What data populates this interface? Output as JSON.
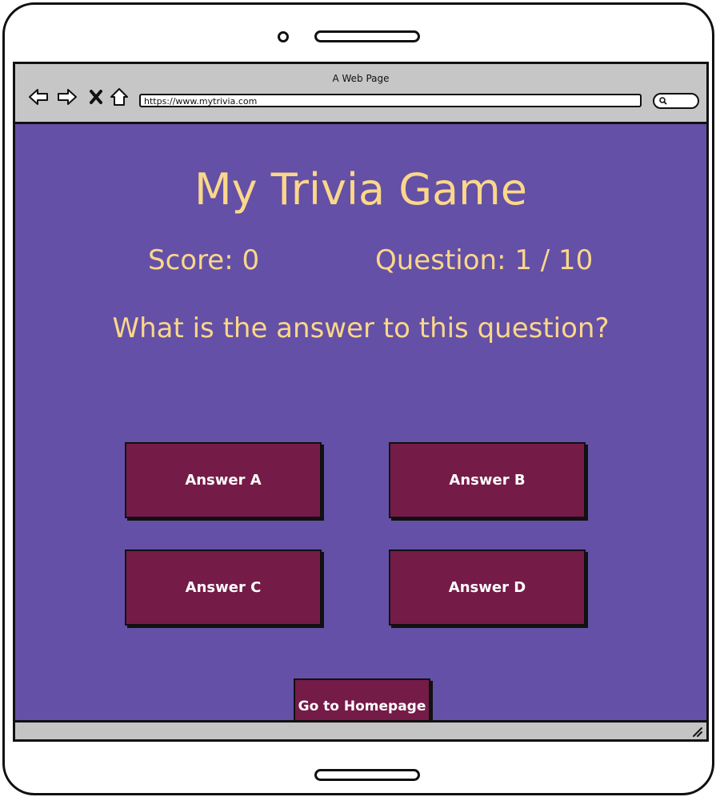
{
  "browser": {
    "window_title": "A Web Page",
    "url": "https://www.mytrivia.com"
  },
  "game": {
    "title": "My Trivia Game",
    "score_text": "Score: 0",
    "question_counter": "Question: 1 / 10",
    "question": "What is the answer to this question?",
    "answers": [
      "Answer A",
      "Answer B",
      "Answer C",
      "Answer D"
    ],
    "home_button": "Go to Homepage"
  },
  "colors": {
    "background": "#6450a6",
    "text_accent": "#fbd78a",
    "button": "#741b47",
    "button_text": "#ffffff"
  }
}
